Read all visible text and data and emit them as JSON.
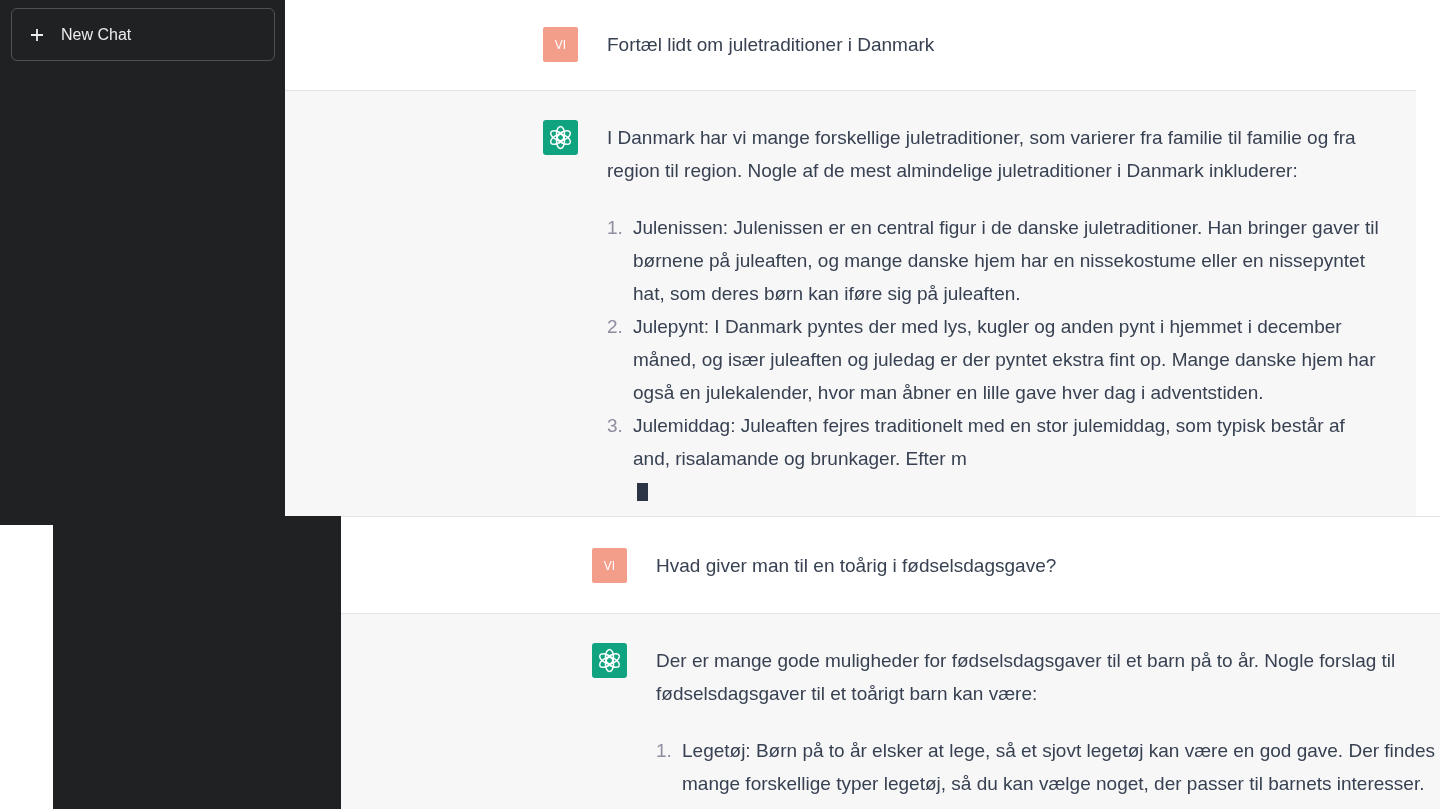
{
  "screenshots": [
    {
      "sidebar": {
        "new_chat_button": "New Chat"
      },
      "messages": [
        {
          "kind": "user",
          "avatar": "VI",
          "text": "Fortæl lidt om juletraditioner i Danmark"
        },
        {
          "kind": "assistant",
          "paragraphs": [
            "I Danmark har vi mange forskellige juletraditioner, som varierer fra familie til familie og fra region til region. Nogle af de mest almindelige juletraditioner i Danmark inkluderer:"
          ],
          "list": [
            {
              "number": "1.",
              "text": "Julenissen: Julenissen er en central figur i de danske juletraditioner. Han bringer gaver til børnene på juleaften, og mange danske hjem har en nissekostume eller en nissepyntet hat, som deres børn kan iføre sig på juleaften."
            },
            {
              "number": "2.",
              "text": "Julepynt: I Danmark pyntes der med lys, kugler og anden pynt i hjemmet i december måned, og især juleaften og juledag er der pyntet ekstra fint op. Mange danske hjem har også en julekalender, hvor man åbner en lille gave hver dag i adventstiden."
            },
            {
              "number": "3.",
              "text": "Julemiddag: Juleaften fejres traditionelt med en stor julemiddag, som typisk består af and, risalamande og brunkager. Efter m"
            }
          ],
          "cursor": true
        }
      ]
    },
    {
      "messages": [
        {
          "kind": "user",
          "avatar": "VI",
          "text": "Hvad giver man til en toårig i fødselsdagsgave?"
        },
        {
          "kind": "assistant",
          "paragraphs": [
            "Der er mange gode muligheder for fødselsdagsgaver til et barn på to år. Nogle forslag til fødselsdagsgaver til et toårigt barn kan være:"
          ],
          "list": [
            {
              "number": "1.",
              "text": "Legetøj: Børn på to år elsker at lege, så et sjovt legetøj kan være en god gave. Der findes mange forskellige typer legetøj, så du kan vælge noget, der passer til barnets interesser."
            }
          ]
        }
      ]
    }
  ]
}
